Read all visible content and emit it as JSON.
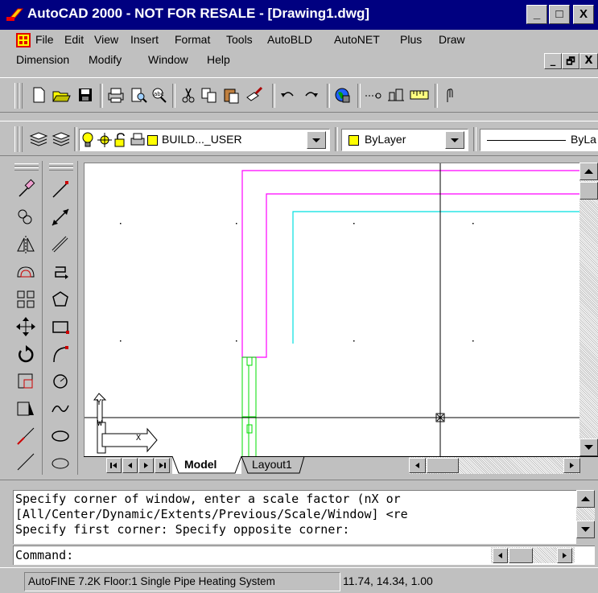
{
  "window": {
    "title": "AutoCAD 2000 - NOT FOR RESALE - [Drawing1.dwg]",
    "minimize": "_",
    "maximize": "□",
    "close": "X"
  },
  "menu": {
    "row1": [
      "File",
      "Edit",
      "View",
      "Insert",
      "Format",
      "Tools",
      "AutoBLD",
      "AutoNET",
      "Plus",
      "Draw"
    ],
    "row2": [
      "Dimension",
      "Modify",
      "Window",
      "Help"
    ],
    "doc_min": "_",
    "doc_restore": "🗗",
    "doc_close": "X"
  },
  "toolbar": {
    "layer_name": "BUILD..._USER",
    "color_value": "ByLayer",
    "linetype_value": "ByLa"
  },
  "layout_tabs": {
    "model": "Model",
    "layout1": "Layout1"
  },
  "command": {
    "lines": [
      "Specify corner of window, enter a scale factor (nX or",
      "[All/Center/Dynamic/Extents/Previous/Scale/Window] <re",
      "Specify first corner: Specify opposite corner:"
    ],
    "prompt": "Command:"
  },
  "status": {
    "app_info": "AutoFINE 7.2K Floor:1 Single Pipe Heating System",
    "coords": "11.74, 14.34, 1.00"
  },
  "ucs": {
    "y_label": "Y",
    "w_label": "W",
    "x_label": "X"
  },
  "colors": {
    "title_bg": "#000080",
    "magenta_lines": "#ff00ff",
    "cyan_line": "#00ffff",
    "green_lines": "#00ff00",
    "face": "#c0c0c0"
  }
}
